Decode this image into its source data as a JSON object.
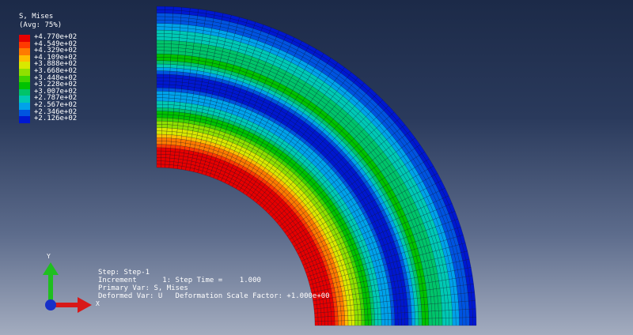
{
  "legend": {
    "variable": "S, Mises",
    "averaging": "(Avg: 75%)",
    "levels": [
      {
        "label": "+4.770e+02",
        "color": "#e60000"
      },
      {
        "label": "+4.549e+02",
        "color": "#ff3a00"
      },
      {
        "label": "+4.329e+02",
        "color": "#ff7a00"
      },
      {
        "label": "+4.109e+02",
        "color": "#ffbd00"
      },
      {
        "label": "+3.888e+02",
        "color": "#d8e800"
      },
      {
        "label": "+3.668e+02",
        "color": "#8fe000"
      },
      {
        "label": "+3.448e+02",
        "color": "#3fd400"
      },
      {
        "label": "+3.228e+02",
        "color": "#00c200"
      },
      {
        "label": "+3.007e+02",
        "color": "#00c46a"
      },
      {
        "label": "+2.787e+02",
        "color": "#00c9b4"
      },
      {
        "label": "+2.567e+02",
        "color": "#00a2ea"
      },
      {
        "label": "+2.346e+02",
        "color": "#0054e0"
      },
      {
        "label": "+2.126e+02",
        "color": "#0018d0"
      }
    ]
  },
  "triad": {
    "y_label": "Y",
    "x_label": "X",
    "y_color": "#1fbf1f",
    "x_color": "#d81818",
    "origin_color": "#1830c8"
  },
  "info": {
    "step": "Step: Step-1",
    "increment": "Increment      1: Step Time =    1.000",
    "primary": "Primary Var: S, Mises",
    "deformed": "Deformed Var: U   Deformation Scale Factor: +1.000e+00"
  }
}
